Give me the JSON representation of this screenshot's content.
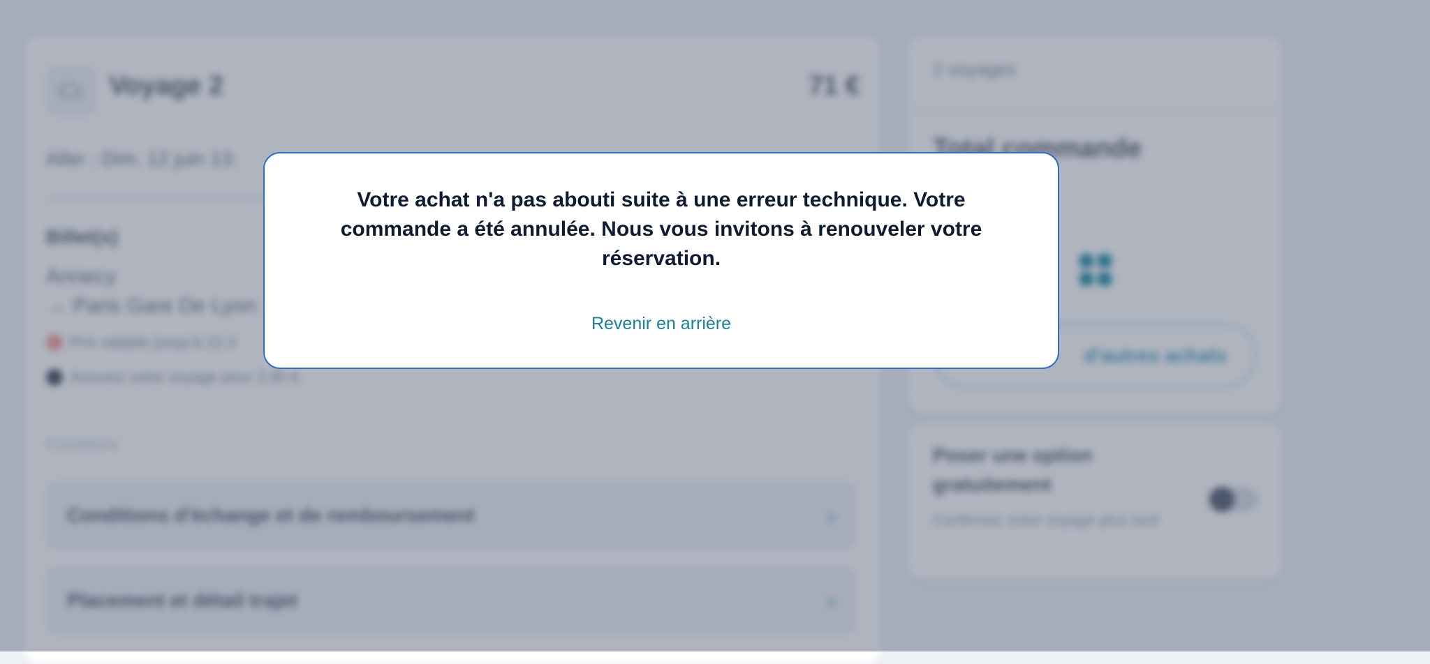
{
  "trip": {
    "title": "Voyage 2",
    "price": "71 €",
    "outbound": "Aller : Dim. 12 juin 13:",
    "tickets_heading": "Billet(s)",
    "origin": "Annecy",
    "destination": "→ Paris Gare De Lyon",
    "price_validity": "Prix valable jusqu'à 22:3",
    "insurance": "Assurez votre voyage pour 2,95 €",
    "conditions_heading": "Conditions",
    "conditions_items": [
      "Conditions d'échange et de remboursement",
      "Placement et détail trajet"
    ]
  },
  "summary": {
    "trip_count": "2 voyages",
    "total_title": "Total commande",
    "other_purchases": "d'autres achats"
  },
  "option": {
    "title": "Poser une option gratuitement",
    "subtitle": "Confirmez votre voyage plus tard",
    "enabled": false
  },
  "modal": {
    "message": "Votre achat n'a pas abouti suite à une erreur technique. Votre commande a été annulée. Nous vous invitons à renouveler votre réservation.",
    "back_link": "Revenir en arrière"
  },
  "colors": {
    "accent": "#1c7f98",
    "modal_border": "#2d6fc7",
    "overlay": "#4e5872"
  },
  "icons": {
    "train": "train-icon",
    "chevron": "chevron-right-icon",
    "grid": "grid-icon"
  }
}
